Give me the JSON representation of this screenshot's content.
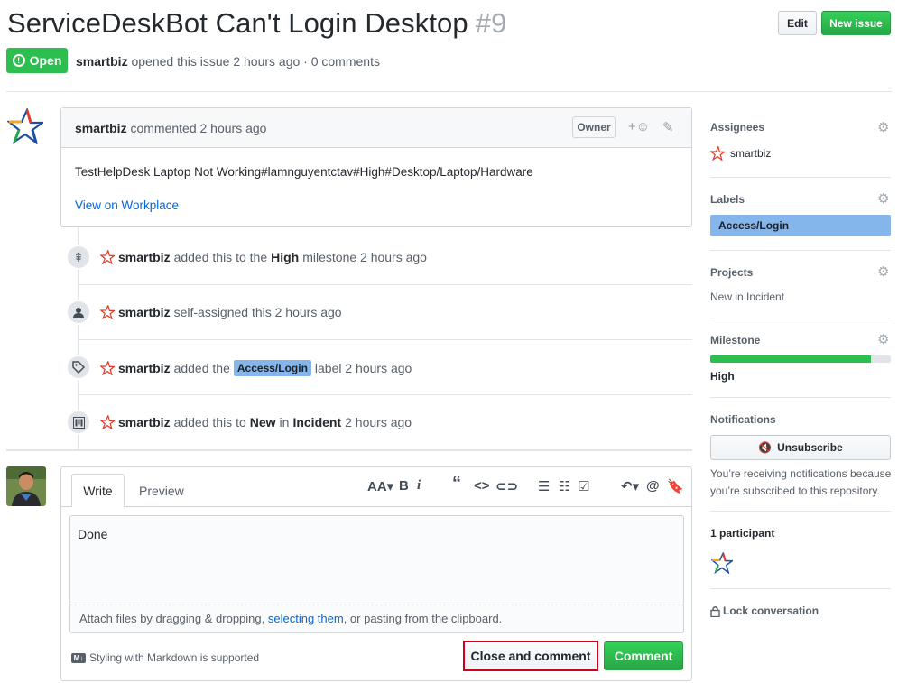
{
  "issue": {
    "title": "ServiceDeskBot Can't Login Desktop",
    "number": "#9",
    "state": "Open",
    "author": "smartbiz",
    "meta_rest": "opened this issue 2 hours ago · 0 comments"
  },
  "header_buttons": {
    "edit": "Edit",
    "new_issue": "New issue"
  },
  "comment": {
    "author": "smartbiz",
    "time": "commented 2 hours ago",
    "badge": "Owner",
    "body": "TestHelpDesk Laptop Not Working#lamnguyentctav#High#Desktop/Laptop/Hardware",
    "link": "View on Workplace"
  },
  "events": [
    {
      "icon": "milestone-icon",
      "glyph": "⇞",
      "actor": "smartbiz",
      "pre": "added this to the",
      "bold": "High",
      "post": "milestone 2 hours ago"
    },
    {
      "icon": "person-icon",
      "glyph": "●",
      "actor": "smartbiz",
      "pre": "self-assigned this 2 hours ago",
      "bold": "",
      "post": ""
    },
    {
      "icon": "tag-icon",
      "glyph": "⬗",
      "actor": "smartbiz",
      "pre": "added the",
      "label": "Access/Login",
      "post": "label 2 hours ago"
    },
    {
      "icon": "project-icon",
      "glyph": "▥",
      "actor": "smartbiz",
      "pre": "added this to",
      "bold": "New",
      "mid": "in",
      "bold2": "Incident",
      "post": "2 hours ago"
    }
  ],
  "form": {
    "tab_write": "Write",
    "tab_preview": "Preview",
    "text": "Done",
    "attach_pre": "Attach files by dragging & dropping,",
    "attach_link": "selecting them",
    "attach_post": ", or pasting from the clipboard.",
    "md_note": "Styling with Markdown is supported",
    "md_badge": "M↓",
    "close_btn": "Close and comment",
    "comment_btn": "Comment"
  },
  "sidebar": {
    "assignees_h": "Assignees",
    "assignee": "smartbiz",
    "labels_h": "Labels",
    "label": "Access/Login",
    "projects_h": "Projects",
    "project": "New in Incident",
    "milestone_h": "Milestone",
    "milestone": "High",
    "milestone_progress": 0.89,
    "notifications_h": "Notifications",
    "unsubscribe": "Unsubscribe",
    "notif_text_1": "You’re receiving notifications because",
    "notif_text_2": "you’re subscribed to this repository.",
    "participants_h": "1 participant",
    "lock": "Lock conversation"
  },
  "colors": {
    "green": "#2cbe4e",
    "label_blue": "#84b6eb",
    "link": "#0366d6",
    "highlight": "#d0021b"
  }
}
